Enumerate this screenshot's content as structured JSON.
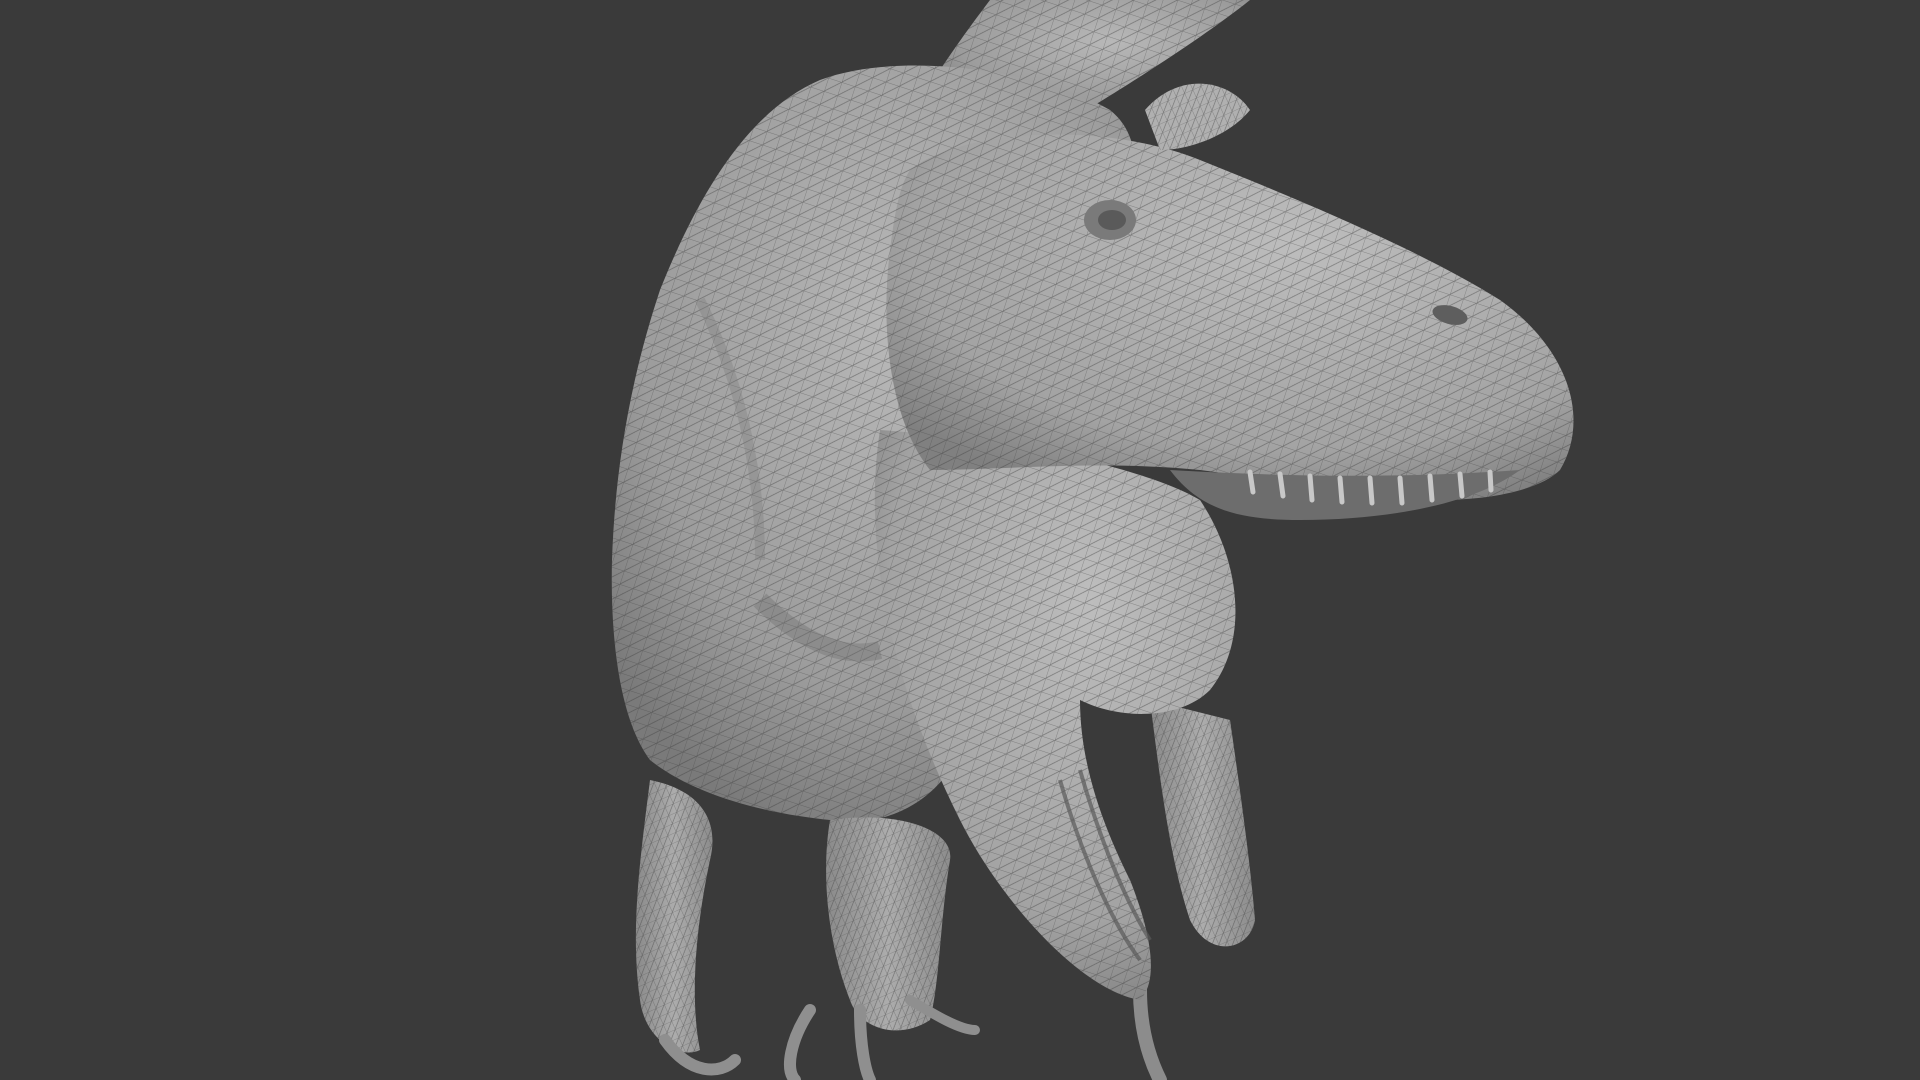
{
  "viewport": {
    "background_color": "#3a3a3a",
    "model_color": "#a9a9a9",
    "model_shadow_color": "#6e6e6e",
    "wire_color": "#3c3c3c",
    "subject": "dinosaur-wireframe-model"
  }
}
